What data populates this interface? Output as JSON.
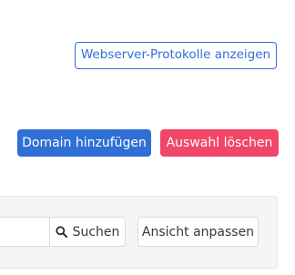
{
  "top_actions": {
    "logs_button_label": "Webserver-Protokolle anzeigen"
  },
  "domain_actions": {
    "add_domain_label": "Domain hinzufügen",
    "delete_selection_label": "Auswahl löschen"
  },
  "filter_bar": {
    "search_value": "",
    "search_button_label": "Suchen",
    "customize_view_label": "Ansicht anpassen"
  },
  "icons": {
    "search": "search-icon"
  },
  "colors": {
    "primary": "#2f6fd6",
    "danger": "#f14668",
    "panel_background": "#f5f5f5",
    "border": "#dbdbdb"
  }
}
